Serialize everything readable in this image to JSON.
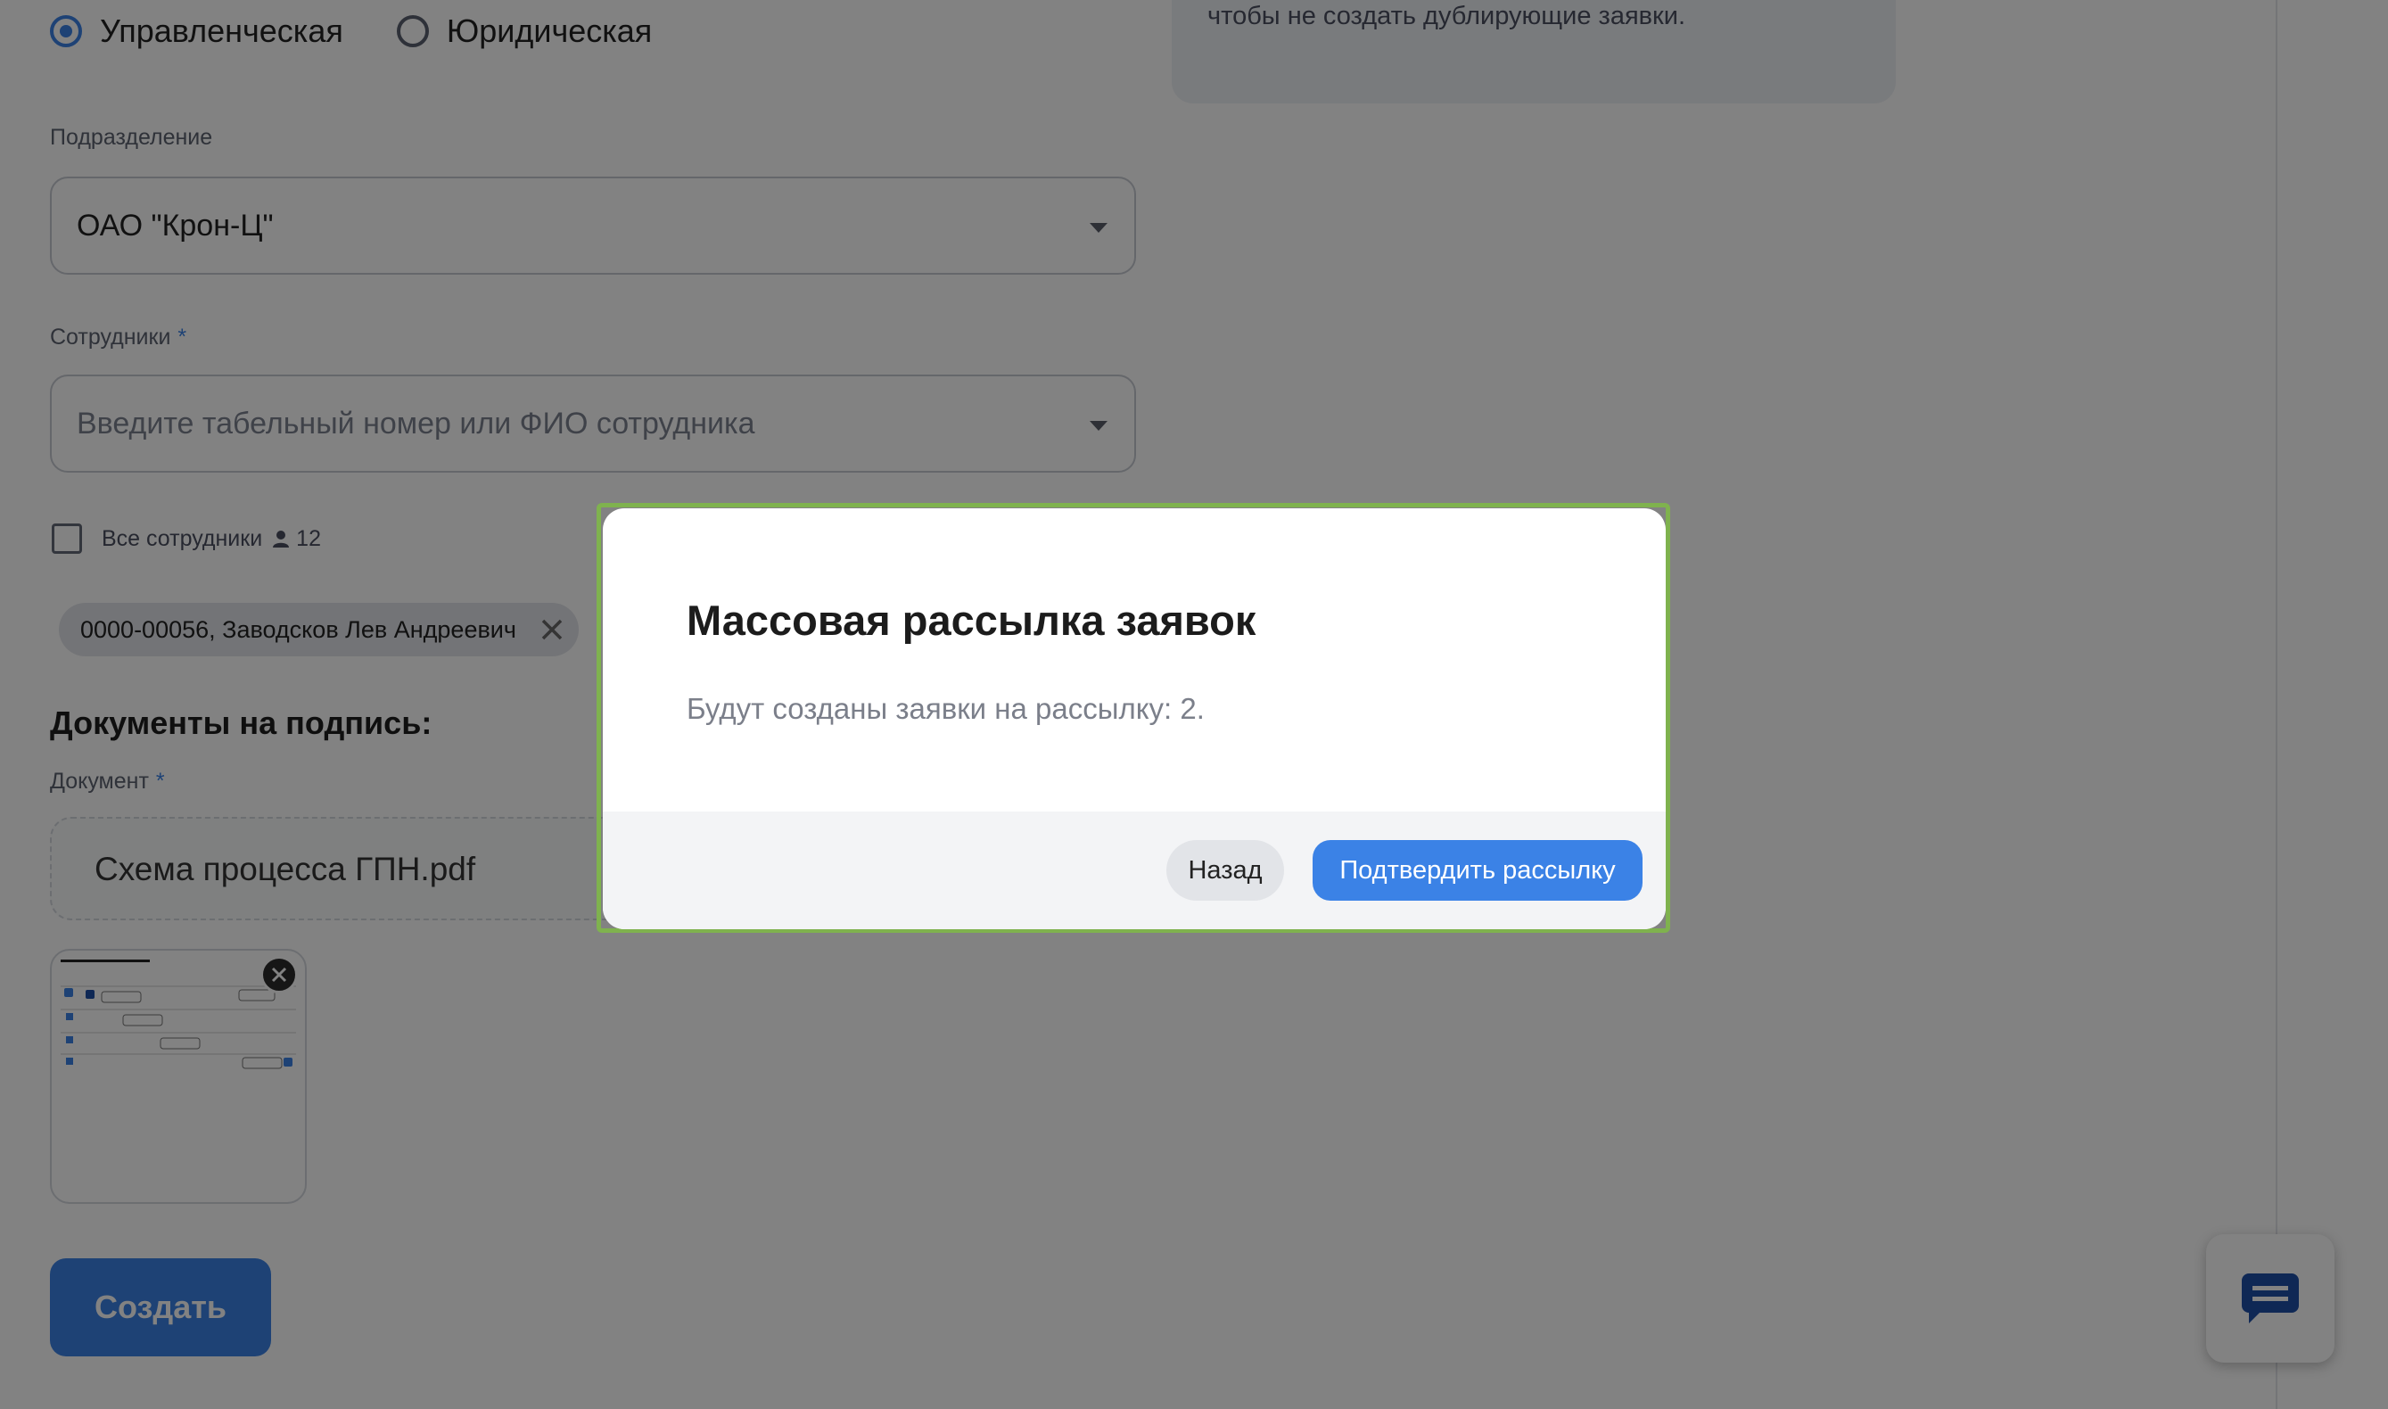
{
  "org_type": {
    "options": [
      {
        "label": "Управленческая",
        "selected": true
      },
      {
        "label": "Юридическая",
        "selected": false
      }
    ]
  },
  "info_box": {
    "text": "чтобы не создать дублирующие заявки."
  },
  "subdivision": {
    "label": "Подразделение",
    "value": "ОАО \"Крон-Ц\""
  },
  "employees": {
    "label": "Сотрудники",
    "required_mark": "*",
    "placeholder": "Введите табельный номер или ФИО сотрудника",
    "all_label": "Все сотрудники",
    "all_count": "12",
    "chips": [
      "0000-00056, Заводсков Лев Андреевич"
    ]
  },
  "documents": {
    "title": "Документы на подпись:",
    "field_label": "Документ",
    "required_mark": "*",
    "file_name": "Схема процесса ГПН.pdf"
  },
  "create_button": "Создать",
  "modal": {
    "title": "Массовая рассылка заявок",
    "body": "Будут созданы заявки на рассылку: 2.",
    "back_label": "Назад",
    "confirm_label": "Подтвердить рассылку"
  },
  "colors": {
    "accent": "#3b82e6",
    "frame": "#7fb24e",
    "overlay": "rgba(0,0,0,0.49)"
  },
  "icons": {
    "chat": "chat-bubble-icon",
    "close": "close-icon",
    "person": "person-icon",
    "caret": "chevron-down-icon"
  }
}
